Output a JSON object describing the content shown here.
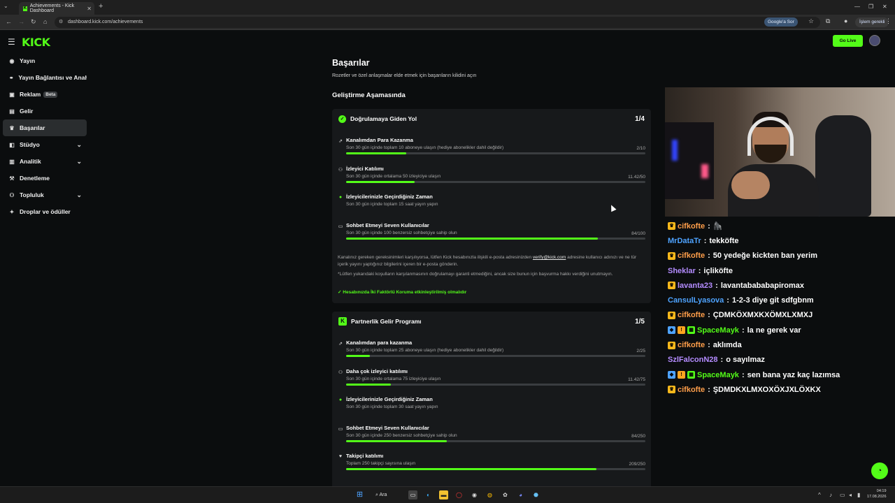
{
  "browser": {
    "tab_title": "Achievements - Kick Dashboard",
    "url": "dashboard.kick.com/achievements",
    "google_button": "Google'a Sor",
    "profile_button": "İşlem gerekli"
  },
  "app": {
    "logo": "KICK",
    "go_live": "Go Live",
    "sidebar": [
      {
        "label": "Yayın",
        "icon": "broadcast-icon"
      },
      {
        "label": "Yayın Bağlantısı ve Anahtarı",
        "icon": "link-icon"
      },
      {
        "label": "Reklam",
        "icon": "ad-icon",
        "badge": "Beta"
      },
      {
        "label": "Gelir",
        "icon": "revenue-icon"
      },
      {
        "label": "Başarılar",
        "icon": "trophy-icon",
        "active": true
      },
      {
        "label": "Stüdyo",
        "icon": "studio-icon",
        "expandable": true
      },
      {
        "label": "Analitik",
        "icon": "analytics-icon",
        "expandable": true
      },
      {
        "label": "Denetleme",
        "icon": "moderation-icon"
      },
      {
        "label": "Topluluk",
        "icon": "community-icon",
        "expandable": true
      },
      {
        "label": "Droplar ve ödüller",
        "icon": "gift-icon"
      }
    ]
  },
  "main": {
    "title": "Başarılar",
    "subtitle": "Rozetler ve özel anlaşmalar elde etmek için başarıların kilidini açın",
    "section_title": "Geliştirme Aşamasında",
    "card1": {
      "title": "Doğrulamaya Giden Yol",
      "count": "1/4",
      "tasks": [
        {
          "title": "Kanalımdan Para Kazanma",
          "desc": "Son 30 gün içinde toplam 10 aboneye ulaşın (hediye abonelikler dahil değildir)",
          "value": "2/10",
          "progress": 0.2,
          "done": false
        },
        {
          "title": "İzleyici Katılımı",
          "desc": "Son 30 gün içinde ortalama 50 izleyiciye ulaşın",
          "value": "11.42/50",
          "progress": 0.23,
          "done": false
        },
        {
          "title": "İzleyicilerinizle Geçirdiğiniz Zaman",
          "desc": "Son 30 gün içinde toplam 15 saat yayın yapın",
          "value": "",
          "progress": null,
          "done": true
        },
        {
          "title": "Sohbet Etmeyi Seven Kullanıcılar",
          "desc": "Son 30 gün içinde 100 benzersiz sohbetçiye sahip olun",
          "value": "84/100",
          "progress": 0.84,
          "done": false
        }
      ],
      "note1_pre": "Kanalınız gereken gereksinimleri karşılıyorsa, lütfen Kick hesabınızla ilişkili e-posta adresinizden",
      "note1_link": "verify@kick.com",
      "note1_post": "adresine kullanıcı adınızı ve ne tür içerik yayını yaptığınız bilgilerini içeren bir e-posta gönderin.",
      "note2": "*Lütfen yukarıdaki koşulların karşılanmasının doğrulamayı garanti etmediğini, ancak size bunun için başvurma hakkı verdiğini unutmayın.",
      "two_factor": "Hesabınızda İki Faktörlü Koruma etkinleştirilmiş olmalıdır"
    },
    "card2": {
      "title": "Partnerlik Gelir Programı",
      "count": "1/5",
      "tasks": [
        {
          "title": "Kanalımdan para kazanma",
          "desc": "Son 30 gün içinde toplam 25 aboneye ulaşın (hediye abonelikler dahil değildir)",
          "value": "2/25",
          "progress": 0.08,
          "done": false
        },
        {
          "title": "Daha çok izleyici katılımı",
          "desc": "Son 30 gün içinde ortalama 75 izleyiciye ulaşın",
          "value": "11.42/75",
          "progress": 0.15,
          "done": false
        },
        {
          "title": "İzleyicilerinizle Geçirdiğiniz Zaman",
          "desc": "Son 30 gün içinde toplam 30 saat yayın yapın",
          "value": "",
          "progress": null,
          "done": true
        },
        {
          "title": "Sohbet Etmeyi Seven Kullanıcılar",
          "desc": "Son 30 gün içinde 250 benzersiz sohbetçiye sahip olun",
          "value": "84/250",
          "progress": 0.336,
          "done": false
        },
        {
          "title": "Takipçi katılımı",
          "desc": "Toplam 250 takipçi sayısına ulaşın",
          "value": "209/250",
          "progress": 0.836,
          "done": false
        }
      ]
    }
  },
  "chat": [
    {
      "user": "cifkofte",
      "color": "#ff9e4a",
      "badges": [
        "gold"
      ],
      "text": "🦍"
    },
    {
      "user": "MrDataTr",
      "color": "#4ea3ff",
      "badges": [],
      "text": "tekköfte"
    },
    {
      "user": "cifkofte",
      "color": "#ff9e4a",
      "badges": [
        "gold"
      ],
      "text": "50 yedeğe kickten ban yerim"
    },
    {
      "user": "Sheklar",
      "color": "#b48cff",
      "badges": [],
      "text": "içliköfte"
    },
    {
      "user": "lavanta23",
      "color": "#b48cff",
      "badges": [
        "gold"
      ],
      "text": "lavantabababapiromax"
    },
    {
      "user": "CansulLyasova",
      "color": "#4ea3ff",
      "badges": [],
      "text": "1-2-3 diye git sdfgbnm"
    },
    {
      "user": "cifkofte",
      "color": "#ff9e4a",
      "badges": [
        "gold"
      ],
      "text": "ÇDMKÖXMXKXÖMXLXMXJ"
    },
    {
      "user": "SpaceMayk",
      "color": "#53fc18",
      "badges": [
        "blue",
        "orange",
        "green"
      ],
      "text": "la ne gerek var"
    },
    {
      "user": "cifkofte",
      "color": "#ff9e4a",
      "badges": [
        "gold"
      ],
      "text": "aklımda"
    },
    {
      "user": "SzlFalconN28",
      "color": "#b48cff",
      "badges": [],
      "text": "o sayılmaz"
    },
    {
      "user": "SpaceMayk",
      "color": "#53fc18",
      "badges": [
        "blue",
        "orange",
        "green"
      ],
      "text": "sen bana yaz kaç lazımsa"
    },
    {
      "user": "cifkofte",
      "color": "#ff9e4a",
      "badges": [
        "gold"
      ],
      "text": "ŞDMDKXLMXOXÖXJXLÖXKX"
    }
  ],
  "taskbar": {
    "search": "Ara",
    "time": "04:19",
    "date": "17.08.2026"
  }
}
